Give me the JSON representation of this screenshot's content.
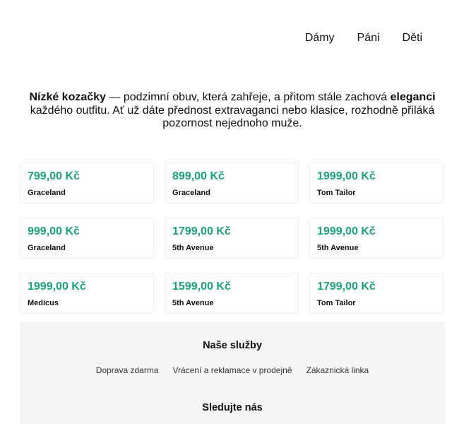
{
  "nav": {
    "items": [
      "Dámy",
      "Páni",
      "Děti"
    ]
  },
  "intro": {
    "bold_1": "Nízké kozačky",
    "text_1": " — podzimní obuv, která zahřeje, a přitom stále zachová ",
    "bold_2": "eleganci",
    "text_2": " každého outfitu. Ať už dáte přednost extravaganci nebo klasice, rozhodně přiláká pozornost nejednoho muže."
  },
  "products": [
    {
      "price": "799,00 Kč",
      "brand": "Graceland"
    },
    {
      "price": "899,00 Kč",
      "brand": "Graceland"
    },
    {
      "price": "1999,00 Kč",
      "brand": "Tom Tailor"
    },
    {
      "price": "999,00 Kč",
      "brand": "Graceland"
    },
    {
      "price": "1799,00 Kč",
      "brand": "5th Avenue"
    },
    {
      "price": "1999,00 Kč",
      "brand": "5th Avenue"
    },
    {
      "price": "1999,00 Kč",
      "brand": "Medicus"
    },
    {
      "price": "1599,00 Kč",
      "brand": "5th Avenue"
    },
    {
      "price": "1799,00 Kč",
      "brand": "Tom Tailor"
    }
  ],
  "footer": {
    "services_title": "Naše služby",
    "services": [
      "Doprava zdarma",
      "Vrácení a reklamace v prodejně",
      "Zákaznická linka"
    ],
    "follow_title": "Sledujte nás"
  },
  "colors": {
    "price": "#1aa37a",
    "footer_bg": "#f5f5f5"
  }
}
